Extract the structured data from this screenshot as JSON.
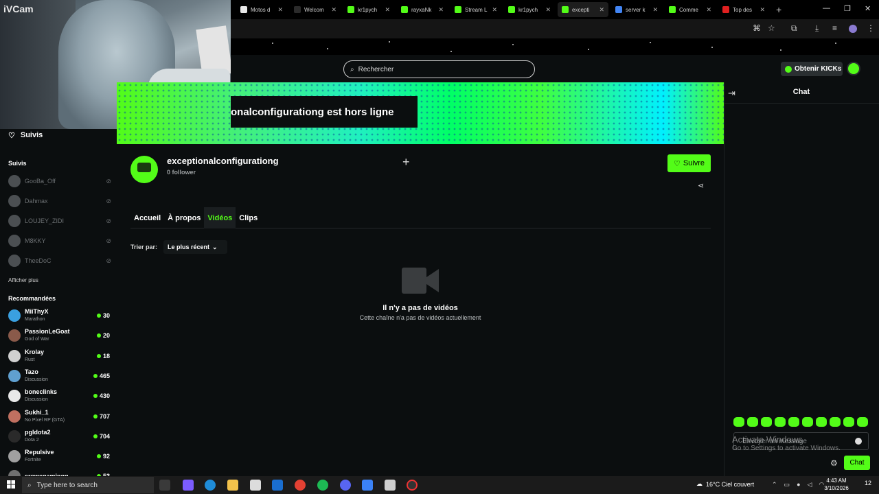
{
  "webcam": {
    "overlay_label": "iVCam"
  },
  "browser": {
    "tabs": [
      {
        "label": "Motos d",
        "icon_color": "#e8e8e8",
        "icon": "M"
      },
      {
        "label": "Welcom",
        "icon_color": "#2b2b2b",
        "icon": "globe"
      },
      {
        "label": "kr1pych",
        "icon_color": "#53fc18",
        "icon": "K"
      },
      {
        "label": "rayxaNk",
        "icon_color": "#53fc18",
        "icon": "K"
      },
      {
        "label": "Stream L",
        "icon_color": "#53fc18",
        "icon": "K"
      },
      {
        "label": "kr1pych",
        "icon_color": "#53fc18",
        "icon": "K"
      },
      {
        "label": "excepti",
        "icon_color": "#53fc18",
        "icon": "K"
      },
      {
        "label": "server k",
        "icon_color": "#4285f4",
        "icon": "G"
      },
      {
        "label": "Comme",
        "icon_color": "#53fc18",
        "icon": "C"
      },
      {
        "label": "Top des",
        "icon_color": "#e02020",
        "icon": "-"
      }
    ]
  },
  "header": {
    "search_placeholder": "Rechercher",
    "kicks_button": "Obtenir KICKs"
  },
  "sidebar": {
    "followed_top_label": "Suivis",
    "followed_section": "Suivis",
    "followed": [
      {
        "name": "GooBa_Off"
      },
      {
        "name": "Dahmax"
      },
      {
        "name": "LOUJEY_ZIDI"
      },
      {
        "name": "M8KKY"
      },
      {
        "name": "TheeDoC"
      }
    ],
    "show_more": "Afficher plus",
    "recommended_section": "Recommandées",
    "recommended": [
      {
        "name": "MiiThyX",
        "category": "Marathon",
        "viewers": "30",
        "color": "#3aa0e0"
      },
      {
        "name": "PassionLeGoat",
        "category": "God of War",
        "viewers": "20",
        "color": "#8a5a4a"
      },
      {
        "name": "Krolay",
        "category": "Rust",
        "viewers": "18",
        "color": "#d0d0d0"
      },
      {
        "name": "Tazo",
        "category": "Discussion",
        "viewers": "465",
        "color": "#60a0d0"
      },
      {
        "name": "boneclinks",
        "category": "Discussion",
        "viewers": "430",
        "color": "#e8e8e8"
      },
      {
        "name": "Sukhi_1",
        "category": "No Pixel RP (GTA)",
        "viewers": "707",
        "color": "#c07060"
      },
      {
        "name": "pgldota2",
        "category": "Dota 2",
        "viewers": "704",
        "color": "#2a2a2a"
      },
      {
        "name": "Repulsive",
        "category": "Fortnite",
        "viewers": "92",
        "color": "#a0a0a0"
      },
      {
        "name": "crowegamingg",
        "category": "",
        "viewers": "53",
        "color": "#707070"
      }
    ]
  },
  "channel": {
    "offline_text": "onalconfigurationg est hors ligne",
    "name": "exceptionalconfigurationg",
    "followers": "0 follower",
    "follow_button": "Suivre",
    "tabs": [
      "Accueil",
      "À propos",
      "Vidéos",
      "Clips"
    ],
    "active_tab": "Vidéos",
    "sort_label": "Trier par:",
    "sort_value": "Le plus récent",
    "empty_title": "Il n'y a pas de vidéos",
    "empty_subtitle": "Cette chaîne n'a pas de vidéos actuellement"
  },
  "chat": {
    "title": "Chat",
    "input_placeholder": "Envoyer un message",
    "send_button": "Chat"
  },
  "watermark": {
    "line1": "Activate Windows",
    "line2": "Go to Settings to activate Windows."
  },
  "taskbar": {
    "search_placeholder": "Type here to search",
    "weather": "16°C  Ciel couvert",
    "time": "4:43 AM",
    "date": "3/10/2026",
    "notification_count": "12"
  },
  "colors": {
    "accent": "#53fc18",
    "background": "#0b0e0f"
  }
}
